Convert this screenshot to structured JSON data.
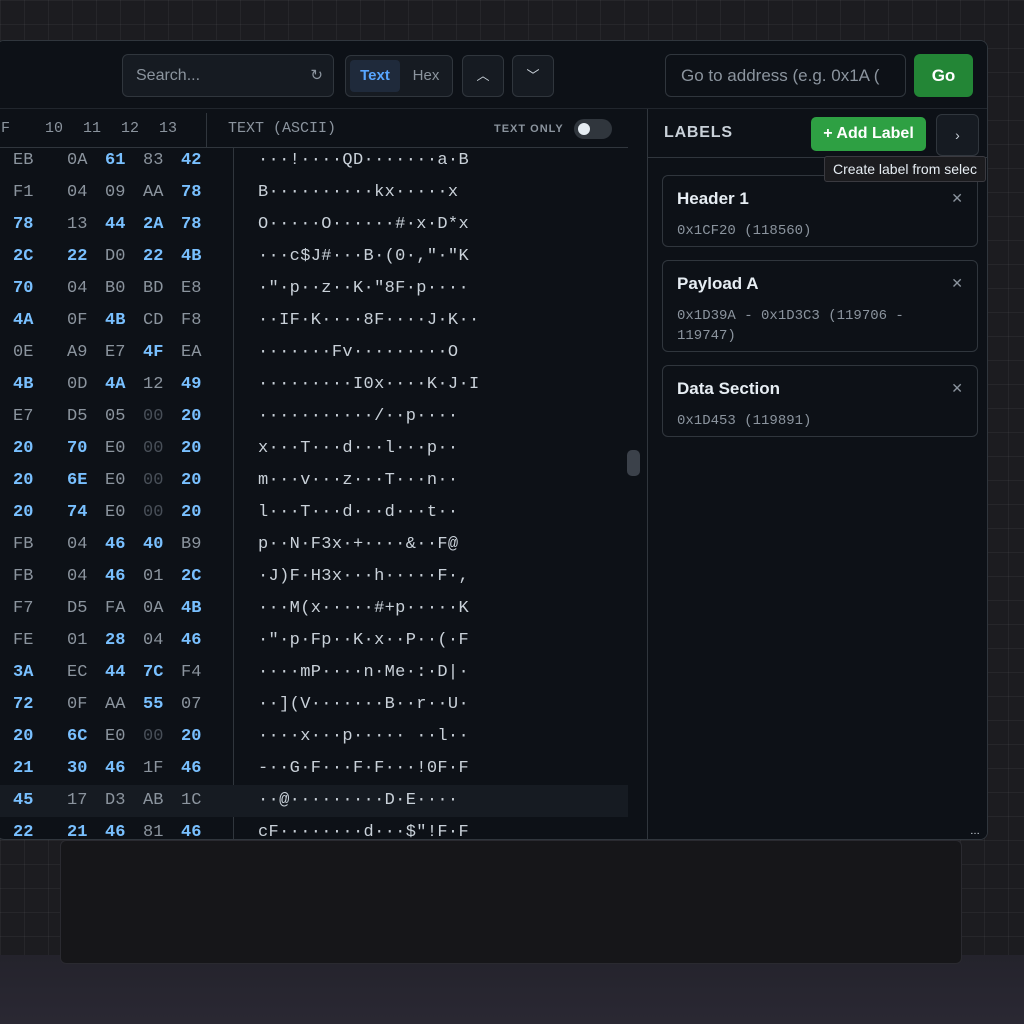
{
  "toolbar": {
    "search_placeholder": "Search...",
    "mode_text": "Text",
    "mode_hex": "Hex",
    "goto_placeholder": "Go to address (e.g. 0x1A (",
    "go_label": "Go"
  },
  "hex_header": {
    "col_f": "F",
    "col_10": "10",
    "col_11": "11",
    "col_12": "12",
    "col_13": "13",
    "ascii_title": "TEXT (ASCII)",
    "text_only_label": "TEXT ONLY"
  },
  "rows": [
    {
      "f": "EB",
      "b10": "0A",
      "b11": "61",
      "b12": "83",
      "b13": "42",
      "ascii": "···!····QD·······a·B"
    },
    {
      "f": "F1",
      "b10": "04",
      "b11": "09",
      "b12": "AA",
      "b13": "78",
      "ascii": "B··········kx·····x"
    },
    {
      "f": "78",
      "b10": "13",
      "b11": "44",
      "b12": "2A",
      "b13": "78",
      "ascii": "O·····O······#·x·D*x"
    },
    {
      "f": "2C",
      "b10": "22",
      "b11": "D0",
      "b12": "22",
      "b13": "4B",
      "ascii": "···c$J#···B·(0·,\"·\"K"
    },
    {
      "f": "70",
      "b10": "04",
      "b11": "B0",
      "b12": "BD",
      "b13": "E8",
      "ascii": "·\"·p··z··K·\"8F·p····"
    },
    {
      "f": "4A",
      "b10": "0F",
      "b11": "4B",
      "b12": "CD",
      "b13": "F8",
      "ascii": "··IF·K····8F····J·K··"
    },
    {
      "f": "0E",
      "b10": "A9",
      "b11": "E7",
      "b12": "4F",
      "b13": "EA",
      "ascii": "·······Fv·········O"
    },
    {
      "f": "4B",
      "b10": "0D",
      "b11": "4A",
      "b12": "12",
      "b13": "49",
      "ascii": "·········I0x····K·J·I"
    },
    {
      "f": "E7",
      "b10": "D5",
      "b11": "05",
      "b12": "00",
      "b13": "20",
      "ascii": "···········/··p····"
    },
    {
      "f": "20",
      "b10": "70",
      "b11": "E0",
      "b12": "00",
      "b13": "20",
      "ascii": "x···T···d···l···p··"
    },
    {
      "f": "20",
      "b10": "6E",
      "b11": "E0",
      "b12": "00",
      "b13": "20",
      "ascii": "m···v···z···T···n··"
    },
    {
      "f": "20",
      "b10": "74",
      "b11": "E0",
      "b12": "00",
      "b13": "20",
      "ascii": "l···T···d···d···t··"
    },
    {
      "f": "FB",
      "b10": "04",
      "b11": "46",
      "b12": "40",
      "b13": "B9",
      "ascii": "p··N·F3x·+····&··F@"
    },
    {
      "f": "FB",
      "b10": "04",
      "b11": "46",
      "b12": "01",
      "b13": "2C",
      "ascii": "·J)F·H3x···h·····F·,"
    },
    {
      "f": "F7",
      "b10": "D5",
      "b11": "FA",
      "b12": "0A",
      "b13": "4B",
      "ascii": "···M(x·····#+p·····K"
    },
    {
      "f": "FE",
      "b10": "01",
      "b11": "28",
      "b12": "04",
      "b13": "46",
      "ascii": "·\"·p·Fp··K·x··P··(·F"
    },
    {
      "f": "3A",
      "b10": "EC",
      "b11": "44",
      "b12": "7C",
      "b13": "F4",
      "ascii": "····mP····n·Me·:·D|·"
    },
    {
      "f": "72",
      "b10": "0F",
      "b11": "AA",
      "b12": "55",
      "b13": "07",
      "ascii": "··](V·······B··r··U·"
    },
    {
      "f": "20",
      "b10": "6C",
      "b11": "E0",
      "b12": "00",
      "b13": "20",
      "ascii": "····x···p····· ··l··"
    },
    {
      "f": "21",
      "b10": "30",
      "b11": "46",
      "b12": "1F",
      "b13": "46",
      "ascii": "-··G·F···F·F···!0F·F"
    },
    {
      "f": "45",
      "b10": "17",
      "b11": "D3",
      "b12": "AB",
      "b13": "1C",
      "ascii": "··@·········D·E····"
    },
    {
      "f": "22",
      "b10": "21",
      "b11": "46",
      "b12": "81",
      "b13": "46",
      "ascii": "cF········d···$\"!F·F"
    }
  ],
  "labels_panel": {
    "title": "LABELS",
    "add_label": "+ Add Label",
    "tooltip": "Create label from selec",
    "items": [
      {
        "name": "Header 1",
        "address": "0x1CF20 (118560)"
      },
      {
        "name": "Payload A",
        "address": "0x1D39A - 0x1D3C3 (119706 - 119747)"
      },
      {
        "name": "Data Section",
        "address": "0x1D453 (119891)"
      }
    ]
  },
  "icons": {
    "refresh": "refresh-icon",
    "chevron_up": "chevron-up-icon",
    "chevron_down": "chevron-down-icon",
    "chevron_right": "chevron-right-icon",
    "close": "close-icon"
  },
  "colors": {
    "accent_blue": "#58a6ff",
    "go_green": "#238636",
    "add_green": "#2ea043",
    "background": "#0d1117"
  }
}
